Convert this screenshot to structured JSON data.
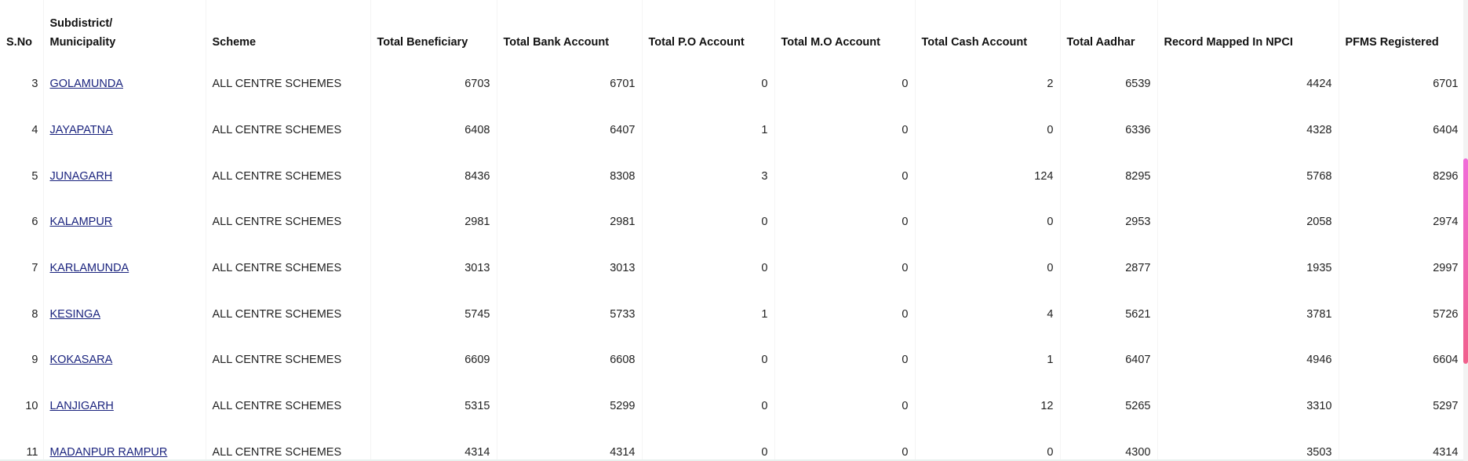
{
  "table": {
    "headers": {
      "sno": "S.No",
      "subdistrict_line1": "Subdistrict/",
      "subdistrict_line2": "Municipality",
      "scheme": "Scheme",
      "total_beneficiary": "Total Beneficiary",
      "total_bank_account": "Total Bank Account",
      "total_po_account": "Total P.O Account",
      "total_mo_account": "Total M.O Account",
      "total_cash_account": "Total Cash Account",
      "total_aadhar": "Total Aadhar",
      "record_mapped_npci": "Record Mapped In NPCI",
      "pfms_registered": "PFMS Registered"
    },
    "rows": [
      {
        "sno": "3",
        "subdistrict": "GOLAMUNDA",
        "scheme": "ALL CENTRE SCHEMES",
        "total_beneficiary": "6703",
        "total_bank_account": "6701",
        "total_po_account": "0",
        "total_mo_account": "0",
        "total_cash_account": "2",
        "total_aadhar": "6539",
        "record_mapped_npci": "4424",
        "pfms_registered": "6701"
      },
      {
        "sno": "4",
        "subdistrict": "JAYAPATNA",
        "scheme": "ALL CENTRE SCHEMES",
        "total_beneficiary": "6408",
        "total_bank_account": "6407",
        "total_po_account": "1",
        "total_mo_account": "0",
        "total_cash_account": "0",
        "total_aadhar": "6336",
        "record_mapped_npci": "4328",
        "pfms_registered": "6404"
      },
      {
        "sno": "5",
        "subdistrict": "JUNAGARH",
        "scheme": "ALL CENTRE SCHEMES",
        "total_beneficiary": "8436",
        "total_bank_account": "8308",
        "total_po_account": "3",
        "total_mo_account": "0",
        "total_cash_account": "124",
        "total_aadhar": "8295",
        "record_mapped_npci": "5768",
        "pfms_registered": "8296"
      },
      {
        "sno": "6",
        "subdistrict": "KALAMPUR",
        "scheme": "ALL CENTRE SCHEMES",
        "total_beneficiary": "2981",
        "total_bank_account": "2981",
        "total_po_account": "0",
        "total_mo_account": "0",
        "total_cash_account": "0",
        "total_aadhar": "2953",
        "record_mapped_npci": "2058",
        "pfms_registered": "2974"
      },
      {
        "sno": "7",
        "subdistrict": "KARLAMUNDA",
        "scheme": "ALL CENTRE SCHEMES",
        "total_beneficiary": "3013",
        "total_bank_account": "3013",
        "total_po_account": "0",
        "total_mo_account": "0",
        "total_cash_account": "0",
        "total_aadhar": "2877",
        "record_mapped_npci": "1935",
        "pfms_registered": "2997"
      },
      {
        "sno": "8",
        "subdistrict": "KESINGA",
        "scheme": "ALL CENTRE SCHEMES",
        "total_beneficiary": "5745",
        "total_bank_account": "5733",
        "total_po_account": "1",
        "total_mo_account": "0",
        "total_cash_account": "4",
        "total_aadhar": "5621",
        "record_mapped_npci": "3781",
        "pfms_registered": "5726"
      },
      {
        "sno": "9",
        "subdistrict": "KOKASARA",
        "scheme": "ALL CENTRE SCHEMES",
        "total_beneficiary": "6609",
        "total_bank_account": "6608",
        "total_po_account": "0",
        "total_mo_account": "0",
        "total_cash_account": "1",
        "total_aadhar": "6407",
        "record_mapped_npci": "4946",
        "pfms_registered": "6604"
      },
      {
        "sno": "10",
        "subdistrict": "LANJIGARH",
        "scheme": "ALL CENTRE SCHEMES",
        "total_beneficiary": "5315",
        "total_bank_account": "5299",
        "total_po_account": "0",
        "total_mo_account": "0",
        "total_cash_account": "12",
        "total_aadhar": "5265",
        "record_mapped_npci": "3310",
        "pfms_registered": "5297"
      },
      {
        "sno": "11",
        "subdistrict": "MADANPUR RAMPUR",
        "scheme": "ALL CENTRE SCHEMES",
        "total_beneficiary": "4314",
        "total_bank_account": "4314",
        "total_po_account": "0",
        "total_mo_account": "0",
        "total_cash_account": "0",
        "total_aadhar": "4300",
        "record_mapped_npci": "3503",
        "pfms_registered": "4314"
      }
    ]
  },
  "colors": {
    "link": "#1a237e",
    "scrollbar_thumb_top": "#f06cd9",
    "scrollbar_thumb_bottom": "#f0608c"
  }
}
